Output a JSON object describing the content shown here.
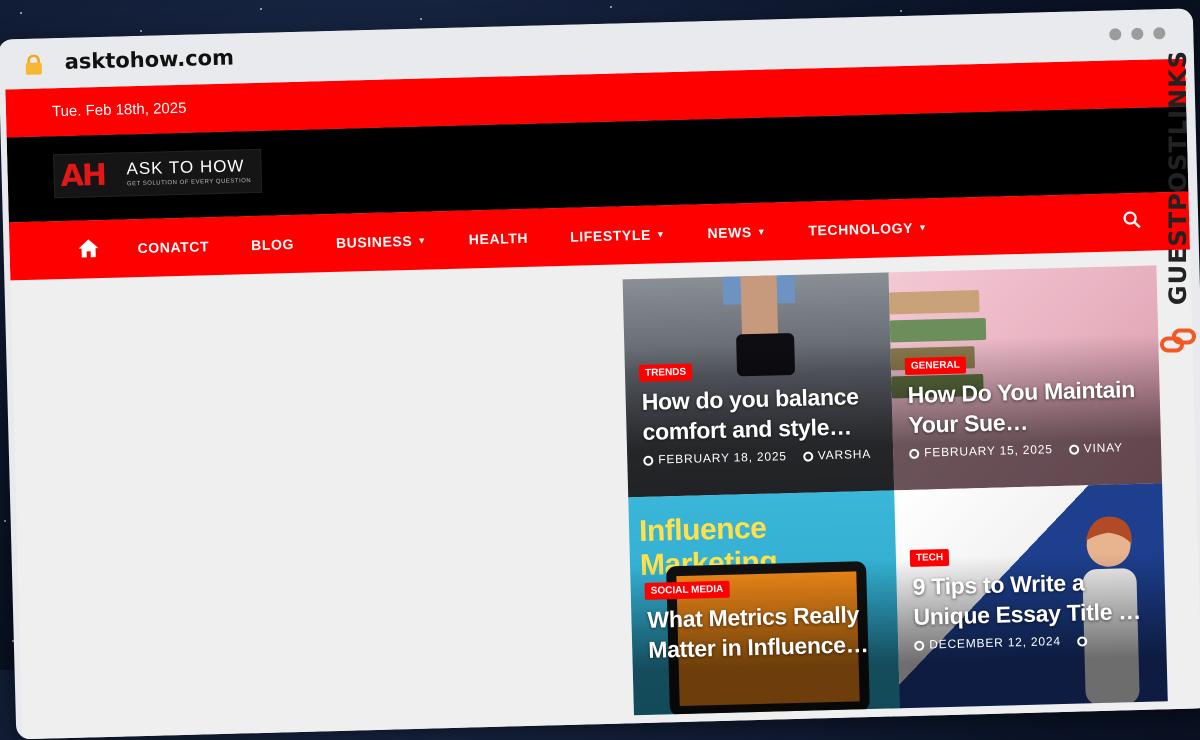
{
  "browser": {
    "url": "asktohow.com",
    "lock_icon": "lock-icon",
    "colors": {
      "lock": "#f7b733",
      "chrome": "#e9eaee"
    }
  },
  "site": {
    "date": "Tue. Feb 18th, 2025",
    "logo": {
      "mark": "AH",
      "name": "ASK TO HOW",
      "tagline": "GET SOLUTION OF EVERY QUESTION"
    },
    "nav": {
      "home_icon": "home-icon",
      "search_icon": "search-icon",
      "items": [
        {
          "label": "CONATCT",
          "dropdown": false
        },
        {
          "label": "BLOG",
          "dropdown": false
        },
        {
          "label": "BUSINESS",
          "dropdown": true
        },
        {
          "label": "HEALTH",
          "dropdown": false
        },
        {
          "label": "LIFESTYLE",
          "dropdown": true
        },
        {
          "label": "NEWS",
          "dropdown": true
        },
        {
          "label": "TECHNOLOGY",
          "dropdown": true
        }
      ]
    },
    "colors": {
      "primary": "#ff0000",
      "header": "#000000",
      "body": "#efefef"
    },
    "posts": [
      {
        "category": "TRENDS",
        "title": "How do you balance comfort and style…",
        "date": "FEBRUARY 18, 2025",
        "author": "VARSHA"
      },
      {
        "category": "GENERAL",
        "title": "How Do You Maintain Your Sue…",
        "date": "FEBRUARY 15, 2025",
        "author": "VINAY"
      },
      {
        "category": "SOCIAL MEDIA",
        "title": "What Metrics Really Matter in Influence…",
        "image_text": "Influence Marketing",
        "date": "",
        "author": ""
      },
      {
        "category": "TECH",
        "title": "9 Tips to Write a Unique Essay Title …",
        "date": "DECEMBER 12, 2024",
        "author": ""
      }
    ]
  },
  "watermark": {
    "text_dark": "GUESTPOSTLINKS",
    "icon": "chain-link-icon",
    "color": "#f15a24"
  }
}
